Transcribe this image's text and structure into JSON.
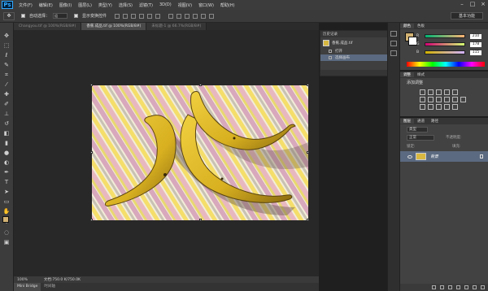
{
  "app": {
    "logo": "Ps"
  },
  "menu": [
    "文件(F)",
    "编辑(E)",
    "图像(I)",
    "图层(L)",
    "类型(Y)",
    "选择(S)",
    "滤镜(T)",
    "3D(D)",
    "视图(V)",
    "窗口(W)",
    "帮助(H)"
  ],
  "window_controls": [
    "–",
    "□",
    "×"
  ],
  "options": {
    "tool_icon": "move-tool-icon",
    "auto_select_label": "自动选择：",
    "auto_select_value": "组",
    "show_transform_label": "显示变换控件",
    "workspace": "基本功能"
  },
  "tabs": [
    {
      "label": "Changyou.tif @ 100%(RGB/8#)",
      "active": false
    },
    {
      "label": "香蕉.成品.tif @ 100%(RGB/8#)",
      "active": true
    },
    {
      "label": "未标题-1 @ 66.7%(RGB/8#)",
      "active": false
    }
  ],
  "status": {
    "zoom": "100%",
    "doc_info": "文档:750.0 K/750.0K"
  },
  "bottom_tabs": [
    "Mini Bridge",
    "时间轴"
  ],
  "history": {
    "tabs": [
      "历史记录"
    ],
    "snapshot": "香蕉.成品.tif",
    "items": [
      {
        "label": "打开",
        "selected": false
      },
      {
        "label": "选择画布",
        "selected": true
      }
    ]
  },
  "color_panel": {
    "tabs": [
      "颜色",
      "色板"
    ],
    "foreground": "#d2b273",
    "background": "#ffffff",
    "channels": [
      {
        "name": "R",
        "value": "210"
      },
      {
        "name": "G",
        "value": "178"
      },
      {
        "name": "B",
        "value": "115"
      }
    ]
  },
  "adjustments": {
    "tabs": [
      "调整",
      "样式"
    ],
    "title": "添加调整"
  },
  "layers": {
    "tabs": [
      "图层",
      "通道",
      "路径"
    ],
    "kind": "类型",
    "mode": "正常",
    "opacity": "不透明度:",
    "lock": "锁定:",
    "fill": "填充:",
    "layer_name": "背景"
  }
}
